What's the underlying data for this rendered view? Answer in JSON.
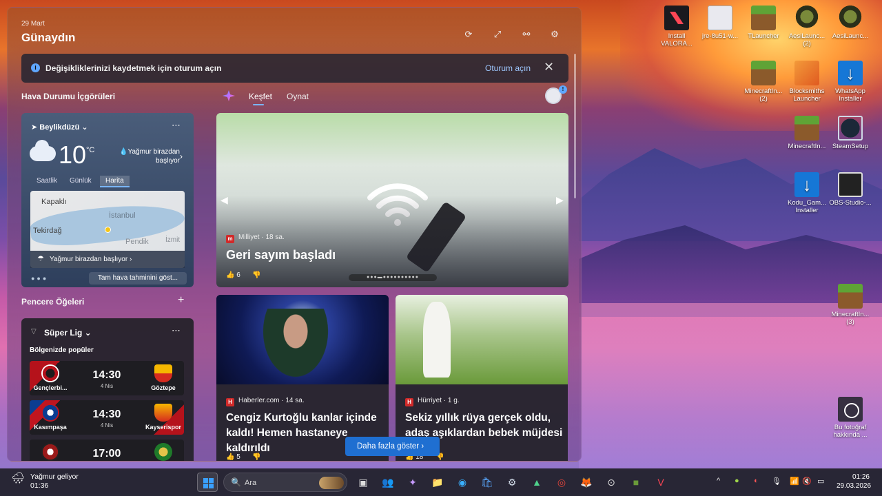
{
  "desktop": {
    "icons": [
      {
        "label": "Install VALORA...",
        "icon": "valorant-icon"
      },
      {
        "label": "jre-8u51-w...",
        "icon": "java-icon"
      },
      {
        "label": "TLauncher",
        "icon": "minecraft-grass-icon"
      },
      {
        "label": "AesiLaunc... (2)",
        "icon": "aesi-launcher-icon"
      },
      {
        "label": "AesiLaunc...",
        "icon": "aesi-launcher-icon"
      },
      {
        "label": "MinecraftIn... (2)",
        "icon": "minecraft-grass-icon"
      },
      {
        "label": "Blocksmiths Launcher",
        "icon": "hammer-icon"
      },
      {
        "label": "WhatsApp Installer",
        "icon": "download-icon"
      },
      {
        "label": "MinecraftIn...",
        "icon": "minecraft-grass-icon"
      },
      {
        "label": "SteamSetup",
        "icon": "steam-icon"
      },
      {
        "label": "Kodu_Gam... Installer",
        "icon": "download-icon"
      },
      {
        "label": "OBS-Studio-...",
        "icon": "obs-icon"
      },
      {
        "label": "MinecraftIn... (3)",
        "icon": "minecraft-grass-icon"
      },
      {
        "label": "Bu fotoğraf hakkında ...",
        "icon": "camera-icon"
      }
    ]
  },
  "widgets": {
    "date": "29 Mart",
    "greeting": "Günaydın",
    "signin_bar": {
      "message": "Değişikliklerinizi kaydetmek için oturum açın",
      "action": "Oturum açın"
    },
    "weather_section_title": "Hava Durumu İçgörüleri",
    "tabs": [
      "Keşfet",
      "Oynat"
    ],
    "weather": {
      "location": "Beylikdüzü",
      "temperature": "10",
      "unit": "°C",
      "condition": "Yağmur birazdan başlıyor",
      "tabs": [
        "Saatlik",
        "Günlük",
        "Harita"
      ],
      "map_labels": [
        "Kapaklı",
        "İstanbul",
        "Tekirdağ",
        "Pendik",
        "İzmit"
      ],
      "map_footer": "Yağmur birazdan başlıyor",
      "full_forecast": "Tam hava tahminini göst..."
    },
    "window_items_title": "Pencere Öğeleri",
    "super_lig": {
      "title": "Süper Lig",
      "subtitle": "Bölgenizde popüler",
      "matches": [
        {
          "home": "Gençlerbi...",
          "away": "Göztepe",
          "time": "14:30",
          "date": "4 Nis"
        },
        {
          "home": "Kasımpaşa",
          "away": "Kayserispor",
          "time": "14:30",
          "date": "4 Nis"
        },
        {
          "home": "",
          "away": "",
          "time": "17:00",
          "date": ""
        }
      ]
    },
    "hero": {
      "source": "Milliyet",
      "age": "18 sa.",
      "title": "Geri sayım başladı",
      "likes": "6"
    },
    "cards": [
      {
        "source": "Haberler.com",
        "age": "14 sa.",
        "title": "Cengiz Kurtoğlu kanlar içinde kaldı! Hemen hastaneye kaldırıldı",
        "likes": "5"
      },
      {
        "source": "Hürriyet",
        "age": "1 g.",
        "title": "Sekiz yıllık rüya gerçek oldu, adaş aşıklardan bebek müjdesi geldi!",
        "likes": "18"
      }
    ],
    "show_more": "Daha fazla göster"
  },
  "taskbar": {
    "weather_title": "Yağmur geliyor",
    "weather_time": "01:36",
    "search_placeholder": "Ara",
    "time": "01:26",
    "date": "29.03.2026"
  },
  "colors": {
    "accent": "#1f6fd1",
    "taskbar": "#202028"
  }
}
